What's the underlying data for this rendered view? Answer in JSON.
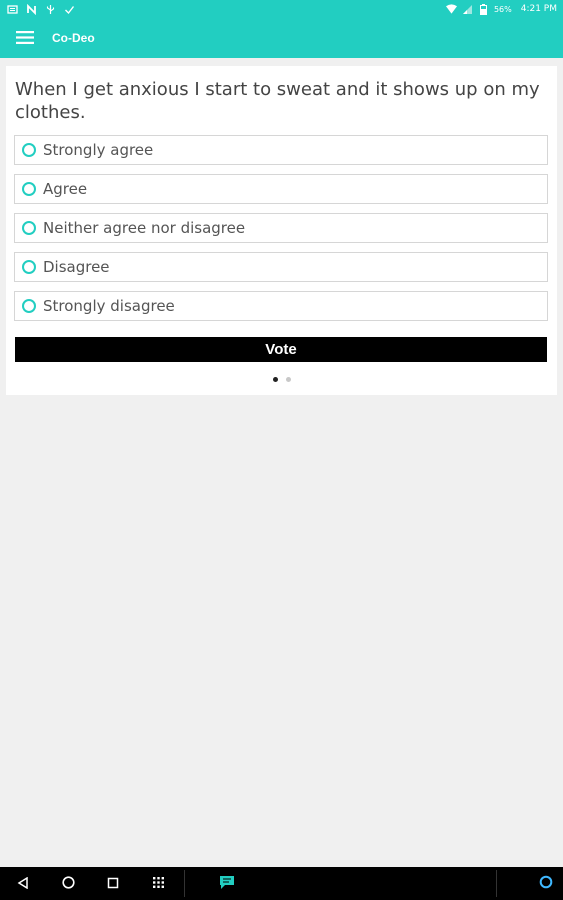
{
  "status_bar": {
    "left_icons": [
      "newspaper-icon",
      "n-icon",
      "usb-icon",
      "check-icon"
    ],
    "battery": "56%",
    "time": "4:21 PM"
  },
  "app_bar": {
    "title": "Co-Deo",
    "menu_icon": "hamburger-menu-icon"
  },
  "poll": {
    "question": "When I get anxious I start to sweat and it shows up on my clothes.",
    "options": [
      {
        "label": "Strongly agree"
      },
      {
        "label": "Agree"
      },
      {
        "label": "Neither agree nor disagree"
      },
      {
        "label": "Disagree"
      },
      {
        "label": "Strongly disagree"
      }
    ],
    "vote_label": "Vote",
    "pager": {
      "current": 1,
      "total": 2
    }
  },
  "nav_bar": {
    "icons": [
      "back-icon",
      "home-icon",
      "recents-icon",
      "app-drawer-icon",
      "chat-app-icon",
      "alexa-icon"
    ]
  },
  "colors": {
    "accent": "#22cec1",
    "button": "#000000",
    "background": "#f0f0f0"
  }
}
